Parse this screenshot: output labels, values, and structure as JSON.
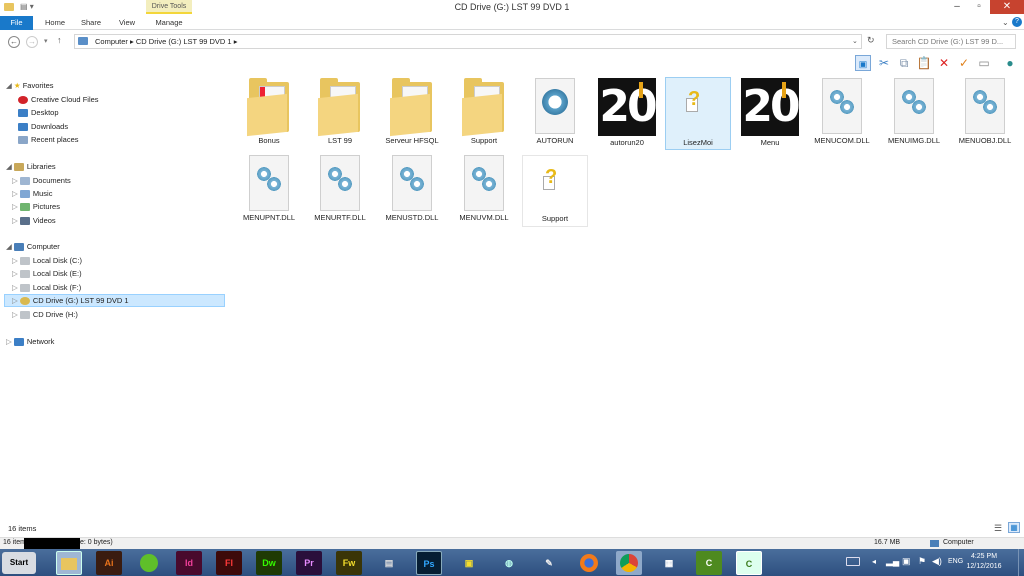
{
  "window": {
    "title": "CD Drive (G:) LST 99 DVD 1"
  },
  "ribbon": {
    "tabs": [
      "File",
      "Home",
      "Share",
      "View",
      "Manage"
    ],
    "contextual_group": "Drive Tools"
  },
  "address": {
    "path": [
      "Computer",
      "CD Drive (G:) LST 99 DVD 1"
    ],
    "search_placeholder": "Search CD Drive (G:) LST 99 D..."
  },
  "nav": {
    "favorites_label": "Favorites",
    "favorites": [
      "Creative Cloud Files",
      "Desktop",
      "Downloads",
      "Recent places"
    ],
    "libraries_label": "Libraries",
    "libraries": [
      "Documents",
      "Music",
      "Pictures",
      "Videos"
    ],
    "computer_label": "Computer",
    "drives": [
      "Local Disk (C:)",
      "Local Disk (E:)",
      "Local Disk (F:)",
      "CD Drive (G:) LST 99 DVD 1",
      "CD Drive (H:)"
    ],
    "network_label": "Network"
  },
  "files": [
    {
      "name": "Bonus",
      "kind": "folder"
    },
    {
      "name": "LST 99",
      "kind": "folder"
    },
    {
      "name": "Serveur HFSQL",
      "kind": "folder"
    },
    {
      "name": "Support",
      "kind": "folder"
    },
    {
      "name": "AUTORUN",
      "kind": "gear-doc"
    },
    {
      "name": "autorun20",
      "kind": "logo20"
    },
    {
      "name": "LisezMoi",
      "kind": "help-doc"
    },
    {
      "name": "Menu",
      "kind": "logo20"
    },
    {
      "name": "MENUCOM.DLL",
      "kind": "gear-doc"
    },
    {
      "name": "MENUIMG.DLL",
      "kind": "gear-doc"
    },
    {
      "name": "MENUOBJ.DLL",
      "kind": "gear-doc"
    },
    {
      "name": "MENUPNT.DLL",
      "kind": "gear-doc"
    },
    {
      "name": "MENURTF.DLL",
      "kind": "gear-doc"
    },
    {
      "name": "MENUSTD.DLL",
      "kind": "gear-doc"
    },
    {
      "name": "MENUVM.DLL",
      "kind": "gear-doc"
    },
    {
      "name": "Support",
      "kind": "help-doc"
    }
  ],
  "logo_text": "20",
  "status": {
    "item_count": "16 items",
    "bottom_left_a": "16 item",
    "bottom_left_b": "e: 0 bytes)",
    "size": "16.7 MB",
    "location": "Computer"
  },
  "taskbar": {
    "start": "Start",
    "apps": [
      {
        "label": "Ai",
        "color": "#e8731c",
        "bg": "#3a1c10"
      },
      {
        "label": "Id",
        "color": "#f0409a",
        "bg": "#490a2d"
      },
      {
        "label": "Fl",
        "color": "#ff3a3a",
        "bg": "#3d0a0a"
      },
      {
        "label": "Dw",
        "color": "#35fa00",
        "bg": "#1f3a04"
      },
      {
        "label": "Pr",
        "color": "#e88cff",
        "bg": "#2a0f3b"
      },
      {
        "label": "Fw",
        "color": "#f4de2c",
        "bg": "#3a3507"
      },
      {
        "label": "Ps",
        "color": "#31a8ff",
        "bg": "#061e33"
      }
    ],
    "tray_lang": "ENG",
    "time": "4:25 PM",
    "date": "12/12/2016"
  }
}
